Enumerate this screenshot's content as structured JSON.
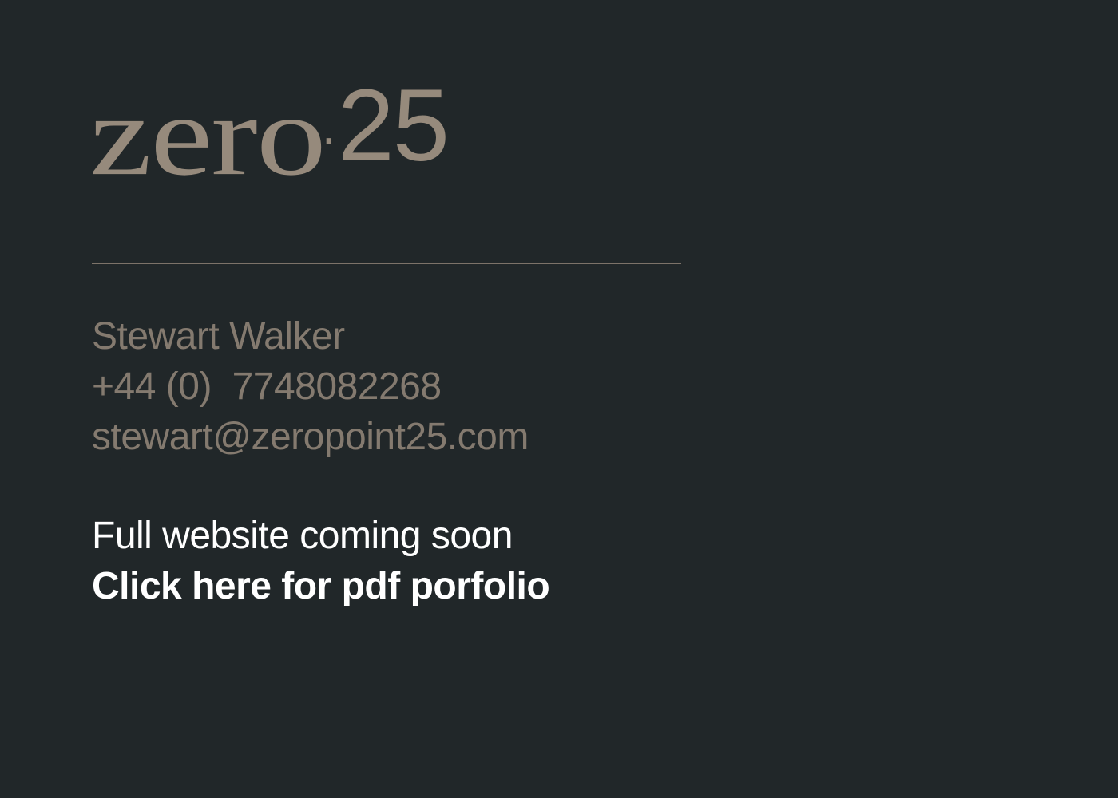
{
  "logo": {
    "word": "zero",
    "dot": ".",
    "number": "25"
  },
  "contact": {
    "name": "Stewart Walker",
    "phone": "+44 (0)  7748082268",
    "email": "stewart@zeropoint25.com"
  },
  "cta": {
    "notice": "Full website coming soon",
    "portfolio_link": "Click here for pdf porfolio"
  },
  "colors": {
    "background": "#212729",
    "logo": "#968a7c",
    "contact_text": "#847a6f",
    "cta_text": "#ffffff"
  }
}
